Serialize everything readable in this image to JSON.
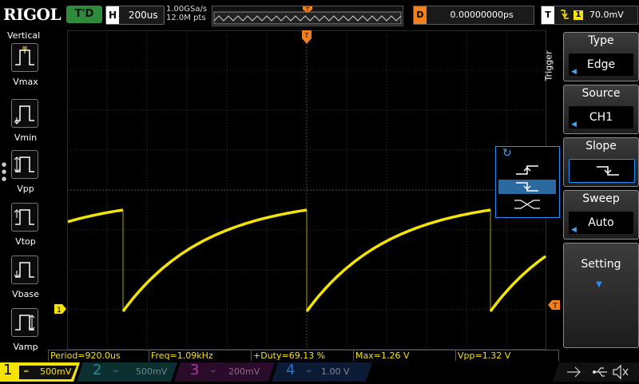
{
  "brand": "RIGOL",
  "status": "T'D",
  "timebase": {
    "label": "H",
    "value": "200us"
  },
  "sample": {
    "rate": "1.00GSa/s",
    "points": "12.0M pts"
  },
  "memory_marker": "T",
  "delay": {
    "label": "D",
    "value": "0.00000000ps"
  },
  "trigger_status": {
    "label": "T",
    "slope_icon": "falling-edge-icon",
    "channel": "1",
    "level": "70.0mV"
  },
  "left_panel": {
    "title": "Vertical",
    "items": [
      {
        "label": "Vmax",
        "icon": "vmax-icon"
      },
      {
        "label": "Vmin",
        "icon": "vmin-icon"
      },
      {
        "label": "Vpp",
        "icon": "vpp-icon"
      },
      {
        "label": "Vtop",
        "icon": "vtop-icon"
      },
      {
        "label": "Vbase",
        "icon": "vbase-icon"
      },
      {
        "label": "Vamp",
        "icon": "vamp-icon"
      }
    ]
  },
  "trigger_side_label": "Trigger",
  "menu": {
    "type": {
      "title": "Type",
      "value": "Edge"
    },
    "source": {
      "title": "Source",
      "value": "CH1"
    },
    "slope": {
      "title": "Slope",
      "value": "falling-edge-icon"
    },
    "sweep": {
      "title": "Sweep",
      "value": "Auto"
    },
    "setting": {
      "title": "Setting"
    }
  },
  "slope_popup": {
    "options": [
      "rising-edge-icon",
      "falling-edge-icon",
      "either-edge-icon"
    ],
    "selected_index": 1
  },
  "ch1_marker": "1",
  "trigger_level_marker": "T",
  "measurements": [
    "Period=920.0us",
    "Freq=1.09kHz",
    "+Duty=69.13 %",
    "Max=1.26 V",
    "Vpp=1.32 V"
  ],
  "channels": [
    {
      "num": "1",
      "scale": "500mV",
      "color": "#f5e400",
      "active": true
    },
    {
      "num": "2",
      "scale": "500mV",
      "color": "#1e8a8a",
      "active": false
    },
    {
      "num": "3",
      "scale": "200mV",
      "color": "#a040a0",
      "active": false
    },
    {
      "num": "4",
      "scale": "1.00 V",
      "color": "#2060c0",
      "active": false
    }
  ],
  "colors": {
    "trace": "#f5e400",
    "grid": "#3a3a3a",
    "accent": "#f08020",
    "select": "#2b6aa0"
  },
  "waveform": {
    "description_values_in_divisions": true,
    "period_ms": 0.92,
    "time_per_div_us": 200,
    "volts_per_div_mv": 500
  }
}
